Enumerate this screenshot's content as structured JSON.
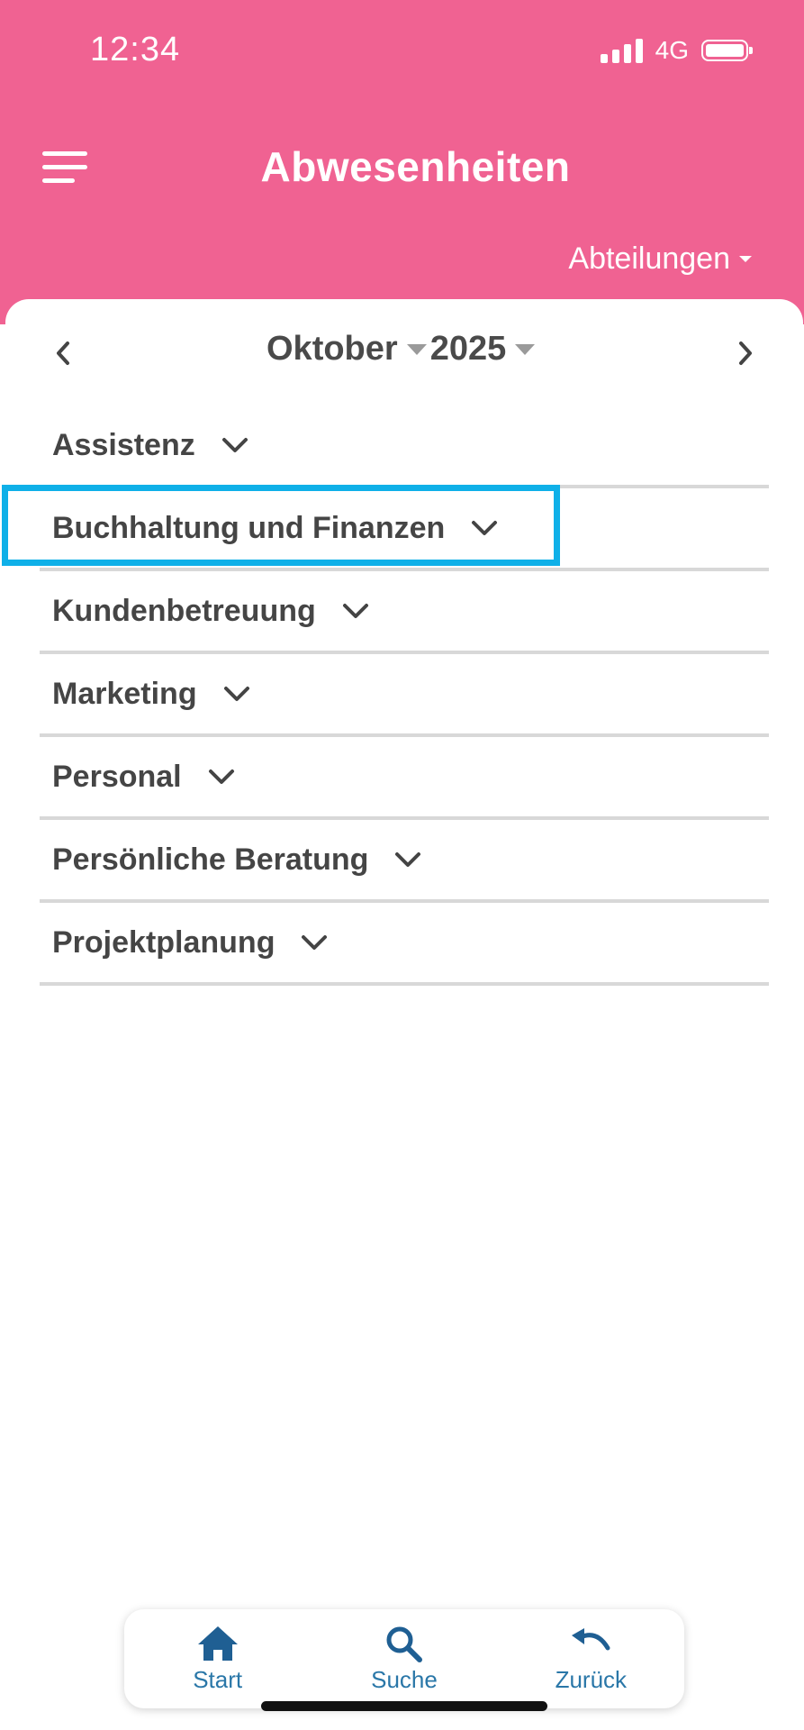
{
  "status_bar": {
    "time": "12:34",
    "network": "4G"
  },
  "header": {
    "title": "Abwesenheiten",
    "filter_label": "Abteilungen"
  },
  "month_nav": {
    "month": "Oktober",
    "year": "2025"
  },
  "departments": [
    "Assistenz",
    "Buchhaltung und Finanzen",
    "Kundenbetreuung",
    "Marketing",
    "Personal",
    "Persönliche Beratung",
    "Projektplanung"
  ],
  "bottom_nav": {
    "start": "Start",
    "search": "Suche",
    "back": "Zurück"
  },
  "colors": {
    "header_bg": "#f06292",
    "highlight": "#0fb0e8",
    "tab_accent": "#2a77a8"
  }
}
